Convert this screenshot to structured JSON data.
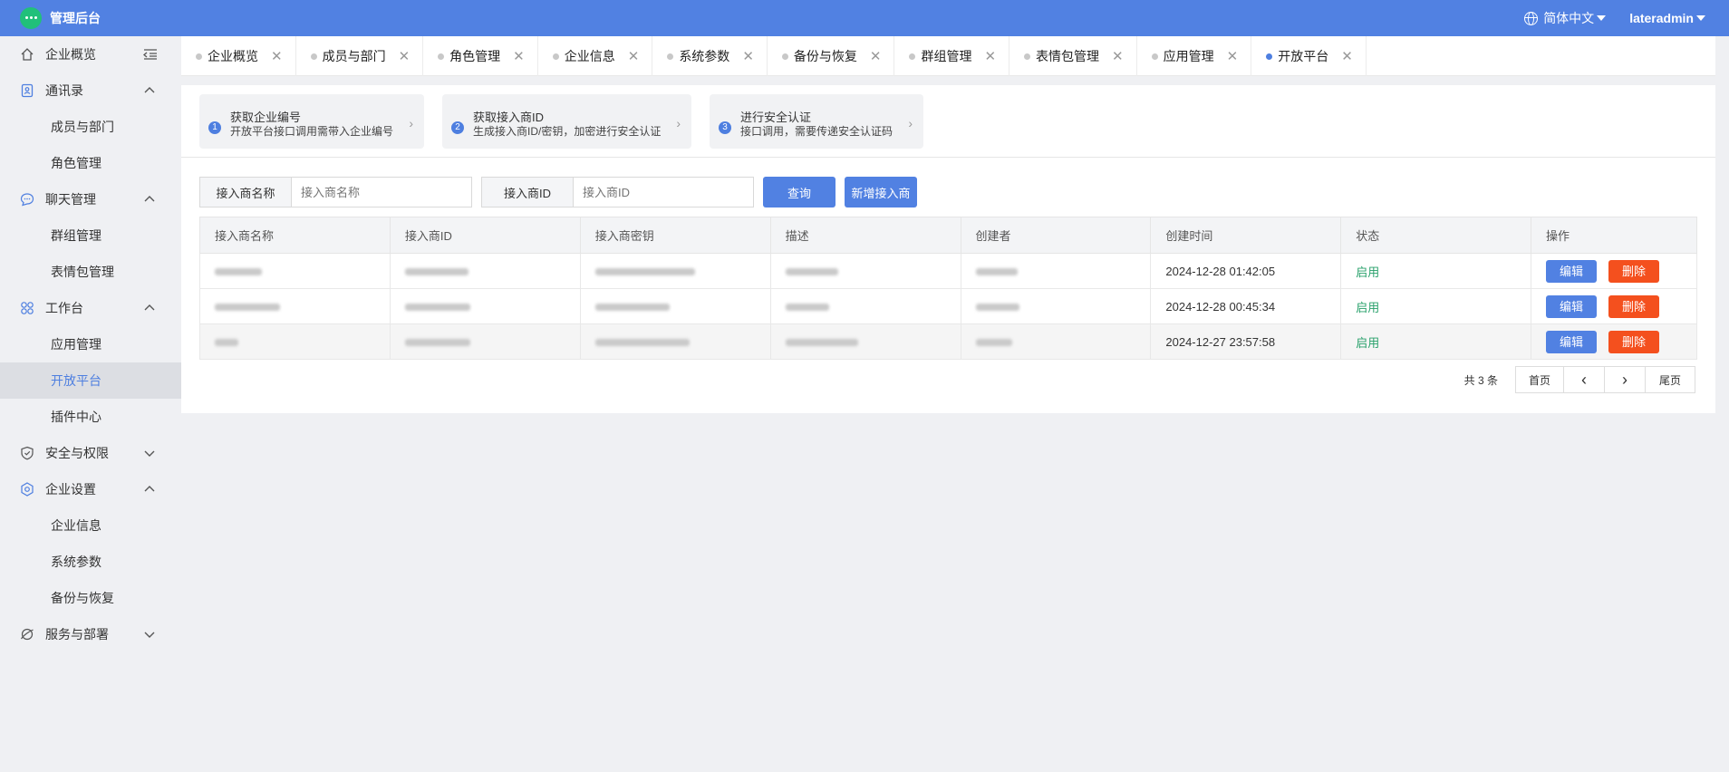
{
  "header": {
    "title": "管理后台",
    "language": "简体中文",
    "user": "lateradmin"
  },
  "sidebar": {
    "items": [
      {
        "label": "企业概览",
        "level": "top",
        "icon": "home-icon"
      },
      {
        "label": "通讯录",
        "level": "top",
        "icon": "contacts-icon",
        "expanded": true
      },
      {
        "label": "成员与部门",
        "level": "sub"
      },
      {
        "label": "角色管理",
        "level": "sub"
      },
      {
        "label": "聊天管理",
        "level": "top",
        "icon": "chat-icon",
        "expanded": true
      },
      {
        "label": "群组管理",
        "level": "sub"
      },
      {
        "label": "表情包管理",
        "level": "sub"
      },
      {
        "label": "工作台",
        "level": "top",
        "icon": "grid-icon",
        "expanded": true
      },
      {
        "label": "应用管理",
        "level": "sub"
      },
      {
        "label": "开放平台",
        "level": "sub",
        "active": true
      },
      {
        "label": "插件中心",
        "level": "sub"
      },
      {
        "label": "安全与权限",
        "level": "top",
        "icon": "shield-icon",
        "expanded": false
      },
      {
        "label": "企业设置",
        "level": "top",
        "icon": "settings-icon",
        "expanded": true
      },
      {
        "label": "企业信息",
        "level": "sub"
      },
      {
        "label": "系统参数",
        "level": "sub"
      },
      {
        "label": "备份与恢复",
        "level": "sub"
      },
      {
        "label": "服务与部署",
        "level": "top",
        "icon": "service-icon",
        "expanded": false
      }
    ]
  },
  "tabs": [
    {
      "label": "企业概览"
    },
    {
      "label": "成员与部门"
    },
    {
      "label": "角色管理"
    },
    {
      "label": "企业信息"
    },
    {
      "label": "系统参数"
    },
    {
      "label": "备份与恢复"
    },
    {
      "label": "群组管理"
    },
    {
      "label": "表情包管理"
    },
    {
      "label": "应用管理"
    },
    {
      "label": "开放平台",
      "active": true
    }
  ],
  "steps": [
    {
      "num": "1",
      "title": "获取企业编号",
      "desc": "开放平台接口调用需带入企业编号"
    },
    {
      "num": "2",
      "title": "获取接入商ID",
      "desc": "生成接入商ID/密钥，加密进行安全认证"
    },
    {
      "num": "3",
      "title": "进行安全认证",
      "desc": "接口调用，需要传递安全认证码"
    }
  ],
  "filters": {
    "name_label": "接入商名称",
    "name_placeholder": "接入商名称",
    "id_label": "接入商ID",
    "id_placeholder": "接入商ID",
    "query_button": "查询",
    "add_button": "新增接入商"
  },
  "table": {
    "headers": [
      "接入商名称",
      "接入商ID",
      "接入商密钥",
      "描述",
      "创建者",
      "创建时间",
      "状态",
      "操作"
    ],
    "rows": [
      {
        "created": "2024-12-28 01:42:05",
        "status": "启用"
      },
      {
        "created": "2024-12-28 00:45:34",
        "status": "启用"
      },
      {
        "created": "2024-12-27 23:57:58",
        "status": "启用"
      }
    ],
    "edit_label": "编辑",
    "delete_label": "删除"
  },
  "pager": {
    "total": "共 3 条",
    "first": "首页",
    "prev": "‹",
    "next": "›",
    "last": "尾页"
  }
}
